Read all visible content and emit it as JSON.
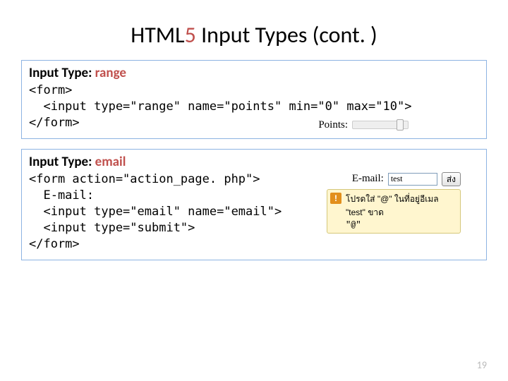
{
  "title_prefix": "HTML",
  "title_five": "5",
  "title_rest": " Input Types (cont. )",
  "section1": {
    "label_prefix": "Input Type: ",
    "keyword": "range",
    "code": "<form>\n  <input type=\"range\" name=\"points\" min=\"0\" max=\"10\">\n</form>",
    "render_label": "Points:"
  },
  "section2": {
    "label_prefix": "Input Type: ",
    "keyword": "email",
    "code": "<form action=\"action_page. php\">\n  E-mail:\n  <input type=\"email\" name=\"email\">\n  <input type=\"submit\">\n</form>",
    "render_label": "E-mail:",
    "render_value": "test",
    "submit_label": "ส่ง",
    "tooltip_line1": "โปรดใส่ \"@\" ในที่อยู่อีเมล \"test\" ขาด",
    "tooltip_line2": "\"@\""
  },
  "page_number": "19"
}
